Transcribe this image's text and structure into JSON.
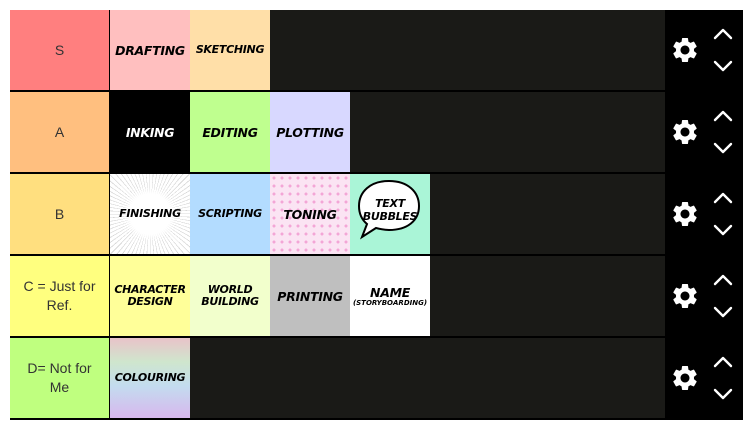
{
  "tiers": [
    {
      "label": "S",
      "color": "#ff7f7f",
      "items": [
        {
          "text": "Drafting",
          "color": "#ffbfbf"
        },
        {
          "text": "Sketching",
          "color": "#ffdfa8"
        }
      ]
    },
    {
      "label": "A",
      "color": "#ffbf7f",
      "items": [
        {
          "text": "Inking",
          "color": "#000000"
        },
        {
          "text": "Editing",
          "color": "#bfff8f"
        },
        {
          "text": "Plotting",
          "color": "#d8d8ff"
        }
      ]
    },
    {
      "label": "B",
      "color": "#ffdf7f",
      "items": [
        {
          "text": "Finishing",
          "color": "#ffffff"
        },
        {
          "text": "Scripting",
          "color": "#b3dcff"
        },
        {
          "text": "Toning",
          "color": "#fbe4f3"
        },
        {
          "text_line1": "Text",
          "text_line2": "Bubbles",
          "color": "#aaf5d7"
        }
      ]
    },
    {
      "label": "C = Just for Ref.",
      "color": "#ffff7f",
      "items": [
        {
          "text_line1": "Character",
          "text_line2": "Design",
          "color": "#ffff99"
        },
        {
          "text_line1": "World",
          "text_line2": "Building",
          "color": "#f2ffcc"
        },
        {
          "text": "Printing",
          "color": "#bfbfbf"
        },
        {
          "text": "Name",
          "subtext": "(Storyboarding)",
          "color": "#ffffff"
        }
      ]
    },
    {
      "label": "D= Not for Me",
      "color": "#bfff7f",
      "items": [
        {
          "text": "Colouring",
          "color": "#e0d0ea"
        }
      ]
    }
  ],
  "controls": {
    "settings_icon": "gear-icon",
    "move_up_icon": "chevron-up-icon",
    "move_down_icon": "chevron-down-icon"
  },
  "colors": {
    "board_background": "#1a1a17",
    "controls_background": "#000000"
  }
}
